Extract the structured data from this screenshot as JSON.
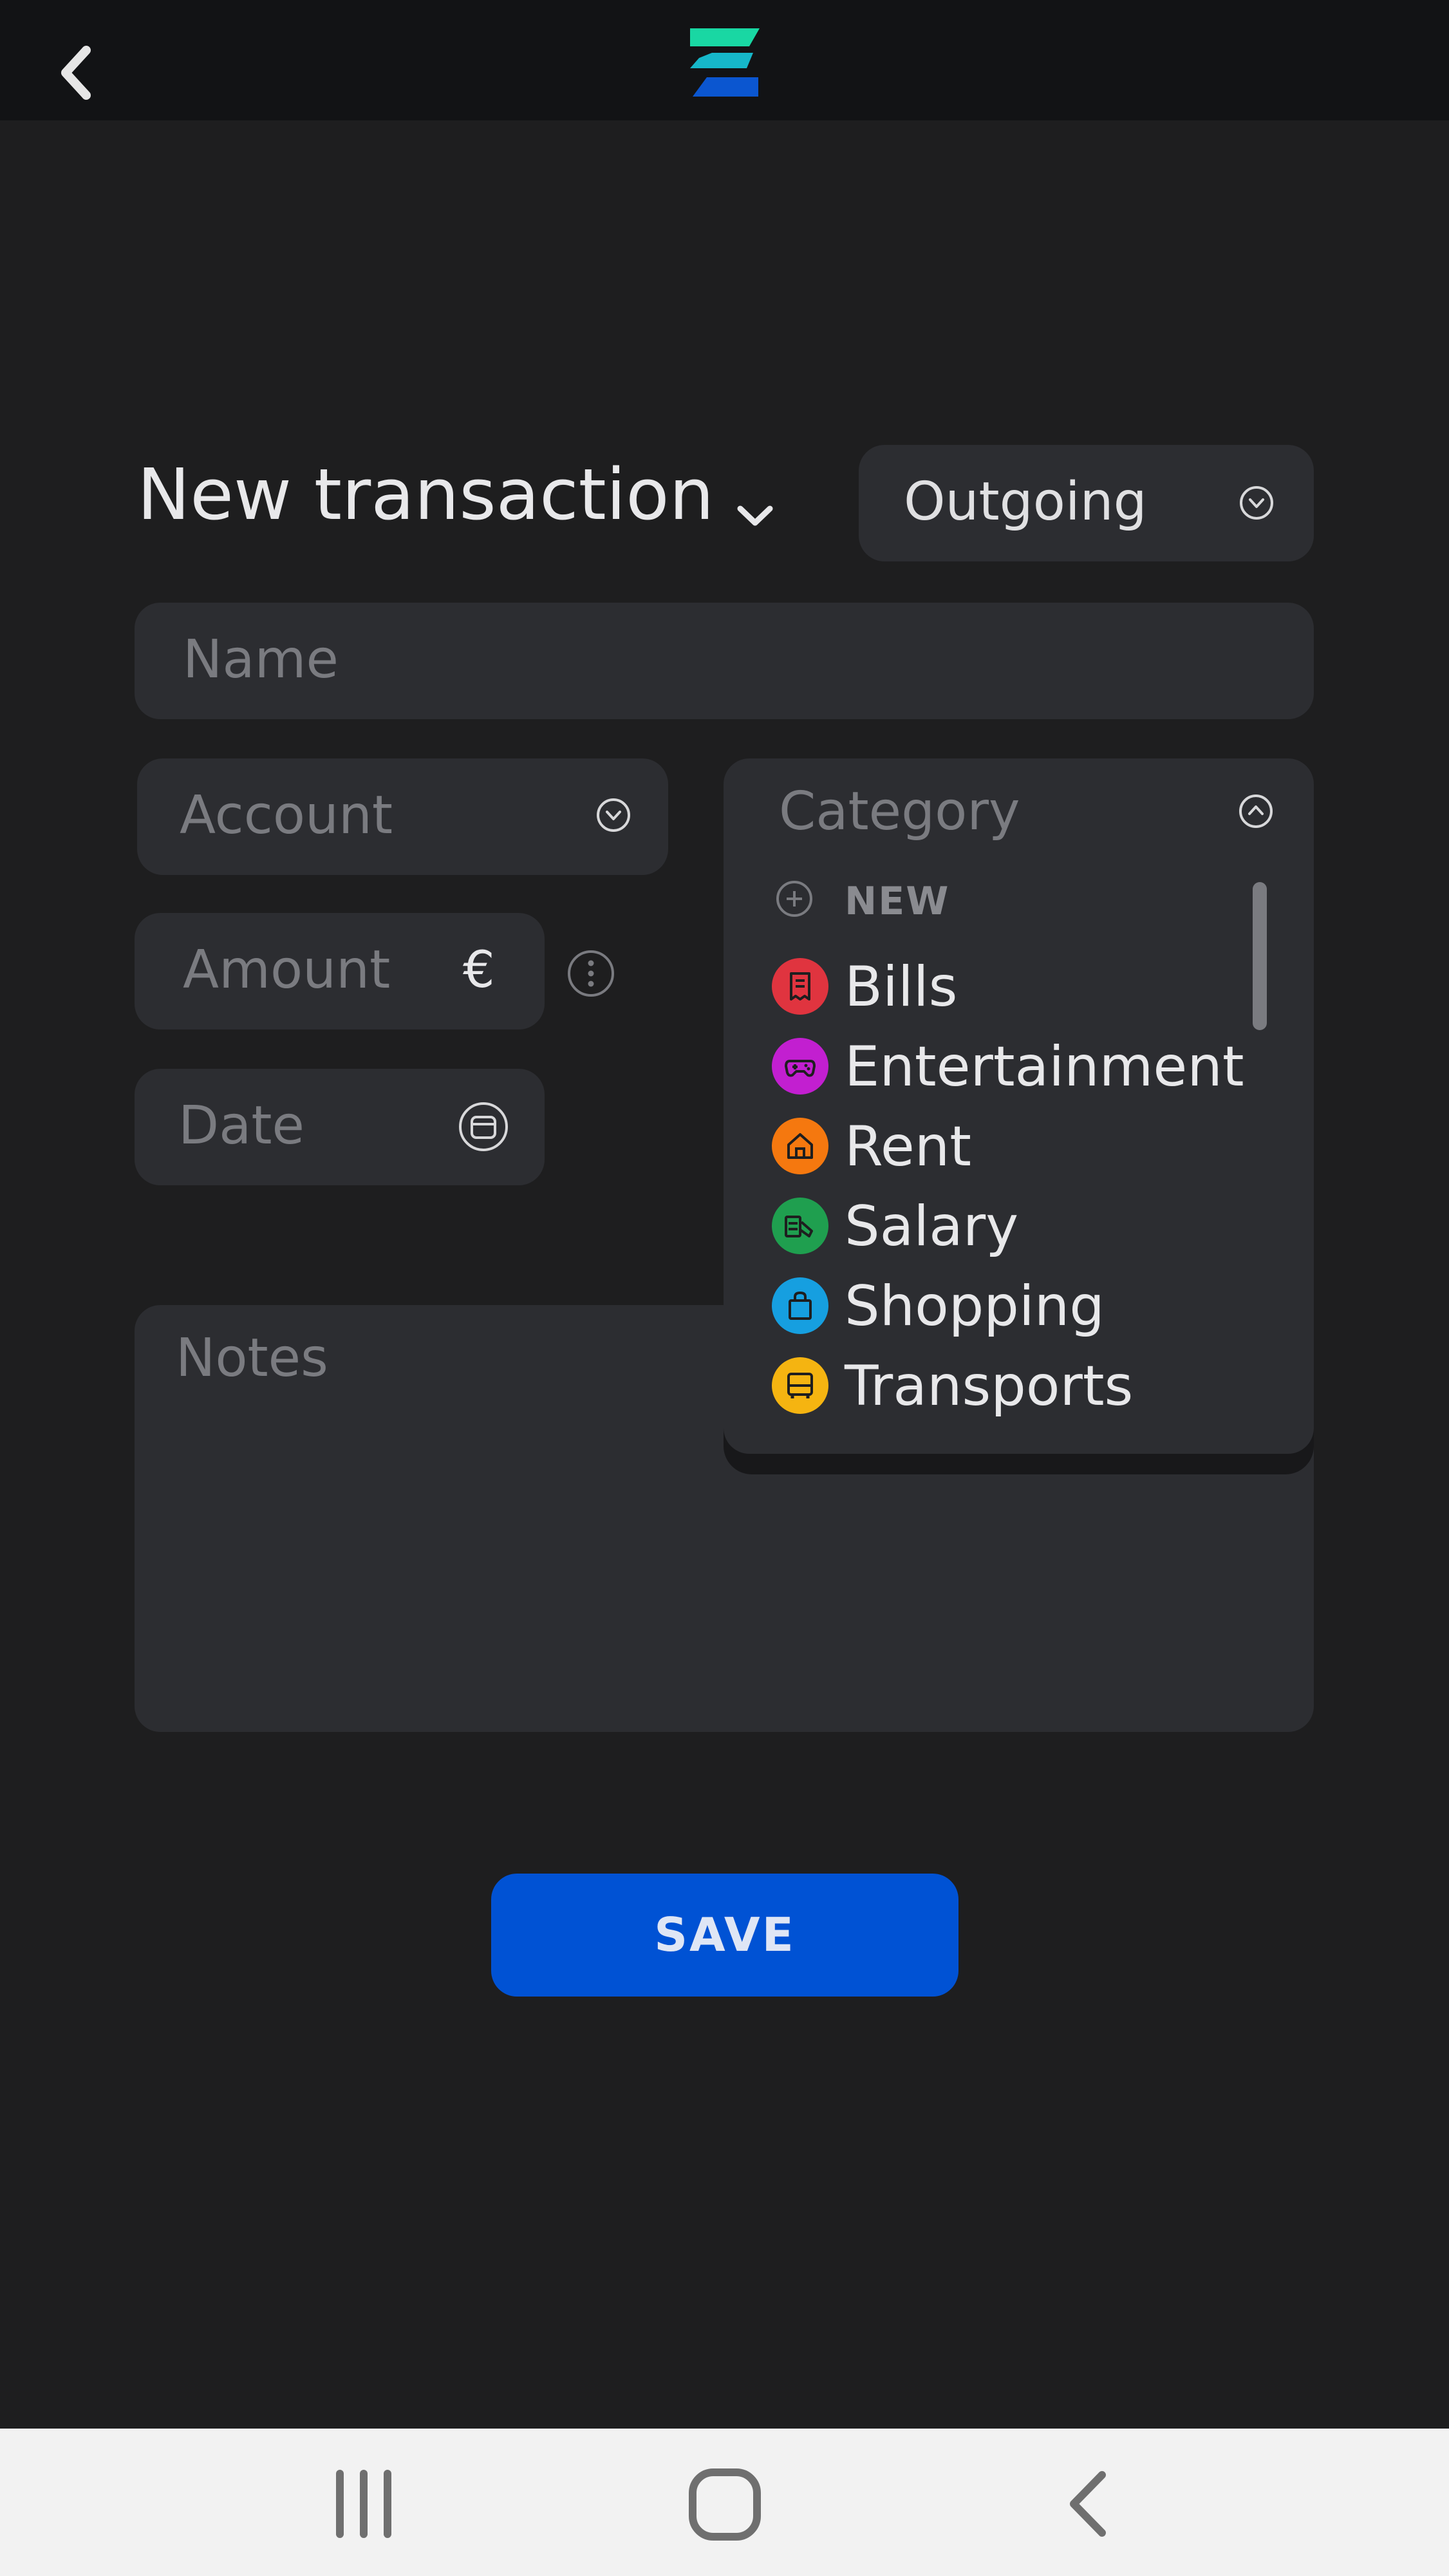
{
  "header": {
    "back_icon": "chevron-left-icon",
    "logo_icon": "app-logo-icon"
  },
  "form": {
    "title": "New transaction",
    "type": {
      "value": "Outgoing"
    },
    "name_placeholder": "Name",
    "account_placeholder": "Account",
    "amount_placeholder": "Amount",
    "currency_symbol": "€",
    "date_placeholder": "Date",
    "notes_placeholder": "Notes",
    "save_label": "SAVE"
  },
  "category": {
    "placeholder": "Category",
    "new_label": "NEW",
    "items": [
      {
        "label": "Bills",
        "color": "#e0343f",
        "icon": "receipt-icon"
      },
      {
        "label": "Entertainment",
        "color": "#c21fd0",
        "icon": "gamepad-icon"
      },
      {
        "label": "Rent",
        "color": "#f5780f",
        "icon": "house-icon"
      },
      {
        "label": "Salary",
        "color": "#1f9f4f",
        "icon": "money-icon"
      },
      {
        "label": "Shopping",
        "color": "#169fe0",
        "icon": "shopping-bag-icon"
      },
      {
        "label": "Transports",
        "color": "#f5b411",
        "icon": "bus-icon"
      }
    ]
  },
  "colors": {
    "accent": "#0052d4",
    "logo_top": "#19d7a3",
    "logo_bottom": "#0b56d0"
  }
}
